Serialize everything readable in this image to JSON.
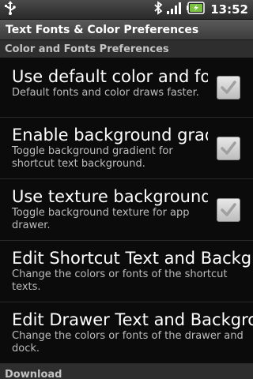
{
  "status_bar": {
    "time": "13:52",
    "icons": [
      "usb-icon",
      "bluetooth-icon",
      "signal-icon",
      "battery-icon"
    ]
  },
  "title": "Text Fonts & Color Preferences",
  "category_color": "Color and Fonts Preferences",
  "preferences": [
    {
      "title": "Use default color and fonts",
      "summary": "Default fonts and color draws faster.",
      "checked": true
    },
    {
      "title": "Enable background gradient",
      "summary": "Toggle background gradient for shortcut text background.",
      "checked": true
    },
    {
      "title": "Use texture background",
      "summary": "Toggle background texture for app drawer.",
      "checked": true
    },
    {
      "title": "Edit Shortcut Text and Background",
      "summary": "Change the colors or fonts of the shortcut texts."
    },
    {
      "title": "Edit Drawer Text and Background",
      "summary": "Change the colors or fonts of the drawer and dock."
    }
  ],
  "category_download": "Download",
  "colors": {
    "background": "#0b0b0b",
    "checkbox_check": "#a0a0a0",
    "battery_accent": "#7ac142"
  }
}
